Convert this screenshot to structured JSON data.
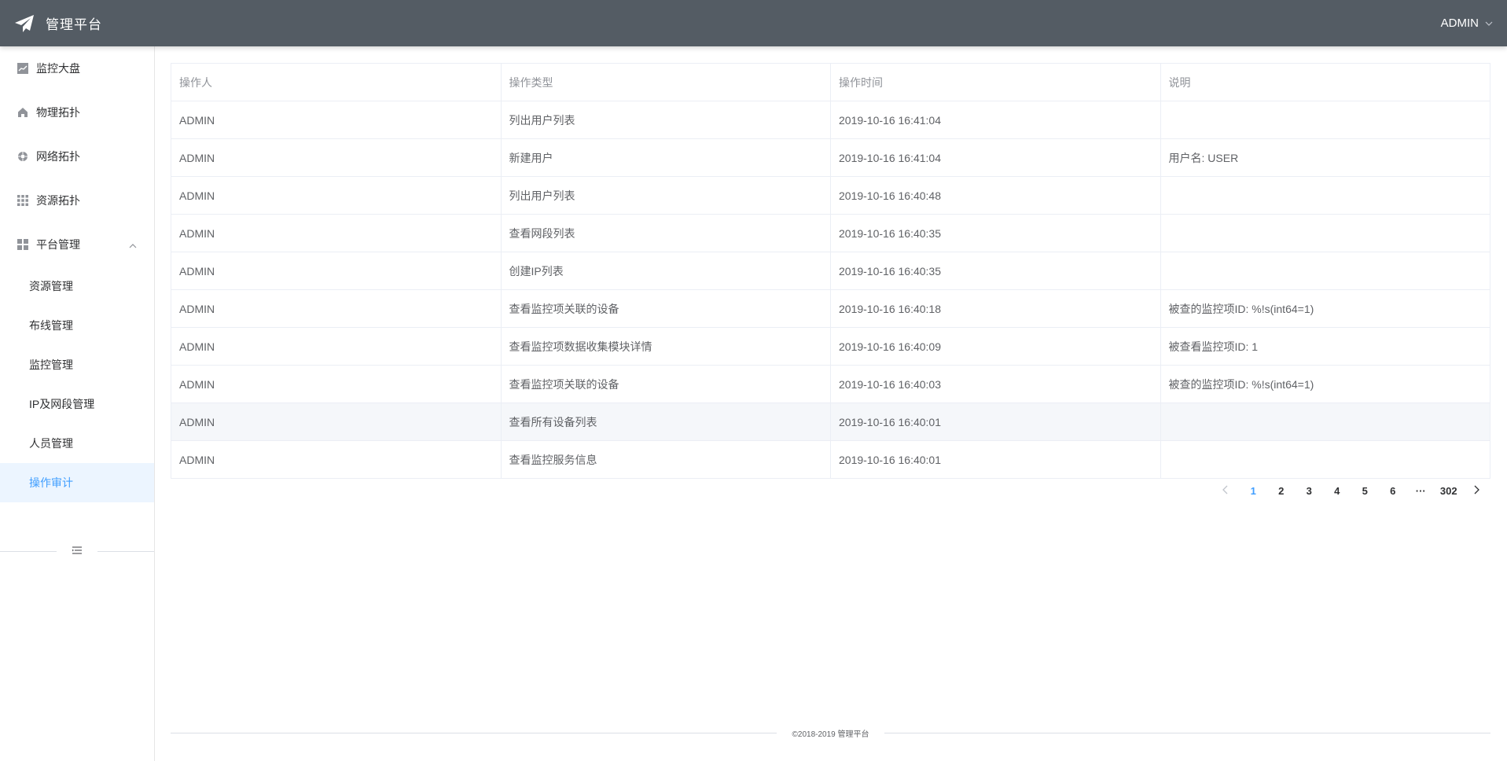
{
  "header": {
    "title": "管理平台",
    "user": "ADMIN"
  },
  "sidebar": {
    "items": [
      {
        "label": "监控大盘",
        "icon": "line-chart-icon"
      },
      {
        "label": "物理拓扑",
        "icon": "home-icon"
      },
      {
        "label": "网络拓扑",
        "icon": "network-icon"
      },
      {
        "label": "资源拓扑",
        "icon": "grid-icon"
      },
      {
        "label": "平台管理",
        "icon": "apps-icon"
      }
    ],
    "sub_items": [
      {
        "label": "资源管理"
      },
      {
        "label": "布线管理"
      },
      {
        "label": "监控管理"
      },
      {
        "label": "IP及网段管理"
      },
      {
        "label": "人员管理"
      },
      {
        "label": "操作审计"
      }
    ]
  },
  "table": {
    "columns": [
      "操作人",
      "操作类型",
      "操作时间",
      "说明"
    ],
    "rows": [
      [
        "ADMIN",
        "列出用户列表",
        "2019-10-16 16:41:04",
        ""
      ],
      [
        "ADMIN",
        "新建用户",
        "2019-10-16 16:41:04",
        "用户名: USER"
      ],
      [
        "ADMIN",
        "列出用户列表",
        "2019-10-16 16:40:48",
        ""
      ],
      [
        "ADMIN",
        "查看网段列表",
        "2019-10-16 16:40:35",
        ""
      ],
      [
        "ADMIN",
        "创建IP列表",
        "2019-10-16 16:40:35",
        ""
      ],
      [
        "ADMIN",
        "查看监控项关联的设备",
        "2019-10-16 16:40:18",
        "被查的监控项ID: %!s(int64=1)"
      ],
      [
        "ADMIN",
        "查看监控项数据收集模块详情",
        "2019-10-16 16:40:09",
        "被查看监控项ID: 1"
      ],
      [
        "ADMIN",
        "查看监控项关联的设备",
        "2019-10-16 16:40:03",
        "被查的监控项ID: %!s(int64=1)"
      ],
      [
        "ADMIN",
        "查看所有设备列表",
        "2019-10-16 16:40:01",
        ""
      ],
      [
        "ADMIN",
        "查看监控服务信息",
        "2019-10-16 16:40:01",
        ""
      ]
    ]
  },
  "pagination": {
    "pages": [
      "1",
      "2",
      "3",
      "4",
      "5",
      "6"
    ],
    "ellipsis": "···",
    "last": "302",
    "current": "1"
  },
  "footer": {
    "text": "©2018-2019 管理平台"
  },
  "colors": {
    "header_bg": "#545c64",
    "accent": "#409eff"
  }
}
